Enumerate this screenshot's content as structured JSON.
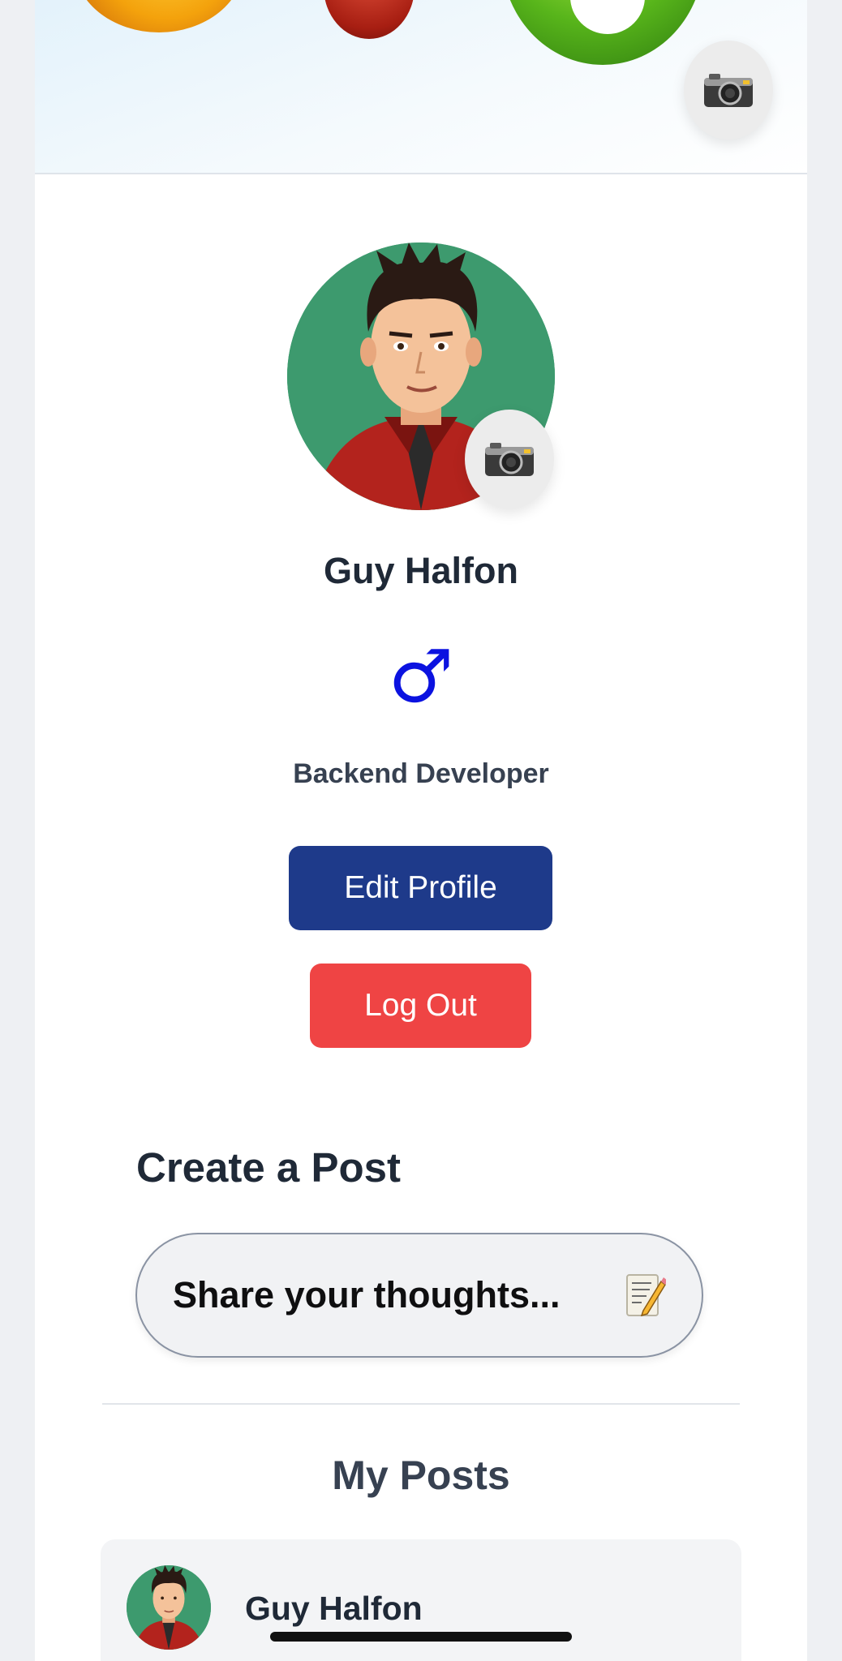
{
  "profile": {
    "name": "Guy Halfon",
    "gender_symbol": "♂",
    "job_title": "Backend Developer"
  },
  "actions": {
    "edit_label": "Edit Profile",
    "logout_label": "Log Out"
  },
  "create_post": {
    "title": "Create a Post",
    "placeholder": "Share your thoughts..."
  },
  "my_posts": {
    "title": "My Posts",
    "posts": [
      {
        "author": "Guy Halfon"
      }
    ]
  },
  "icons": {
    "cover_camera": "camera-icon",
    "avatar_camera": "camera-icon",
    "memo": "memo-pencil-icon"
  },
  "colors": {
    "edit_button": "#1e3a8a",
    "logout_button": "#ef4444",
    "gender_symbol": "#0b12e0",
    "avatar_bg": "#3d9a6e"
  }
}
